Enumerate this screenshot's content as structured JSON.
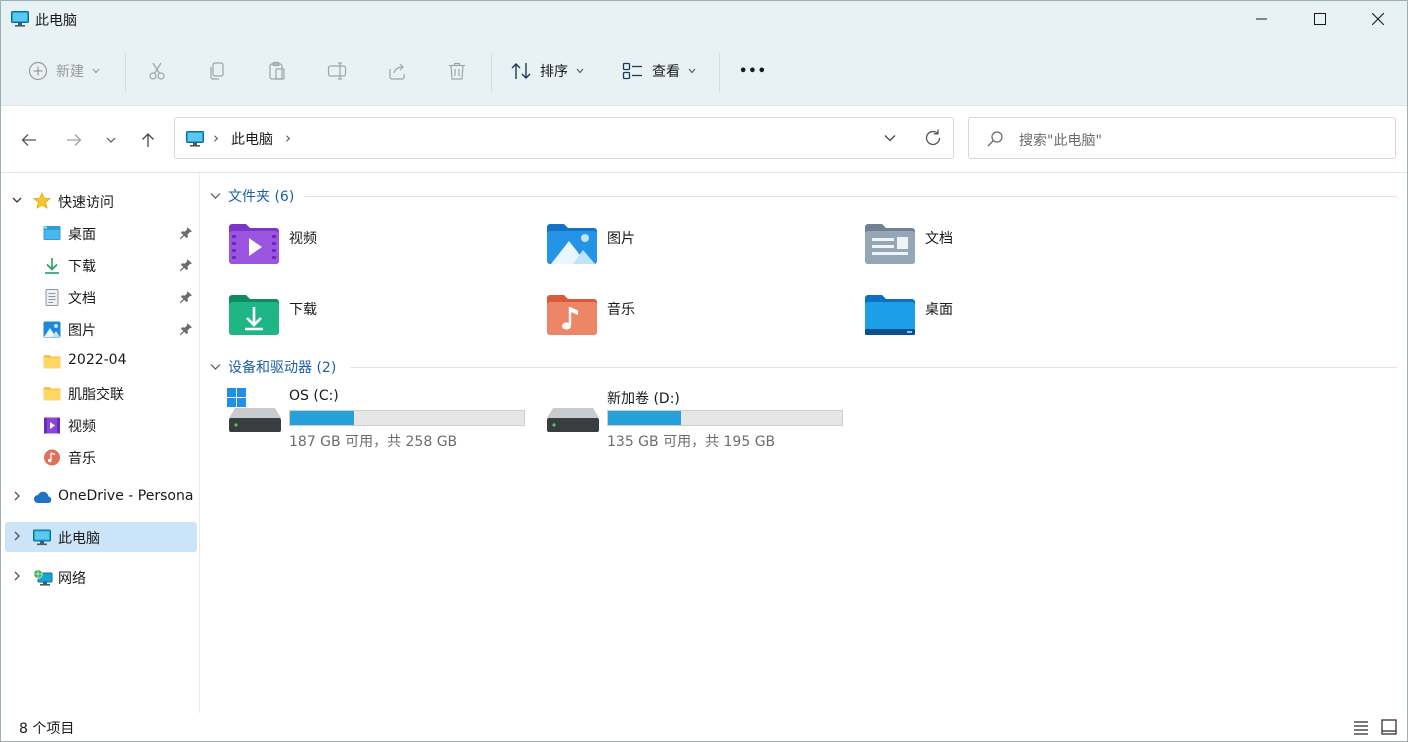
{
  "window": {
    "title": "此电脑",
    "controls": [
      "minimize-icon",
      "maximize-icon",
      "close-icon"
    ]
  },
  "toolbar": {
    "new_label": "新建",
    "sort_label": "排序",
    "view_label": "查看",
    "more_label": "•••"
  },
  "address": {
    "separator": "›",
    "location": "此电脑",
    "search_placeholder": "搜索\"此电脑\""
  },
  "sidebar": {
    "quick_access": "快速访问",
    "items": [
      {
        "label": "桌面",
        "icon": "desktop-folder-icon",
        "pinned": true
      },
      {
        "label": "下载",
        "icon": "download-icon",
        "pinned": true
      },
      {
        "label": "文档",
        "icon": "document-icon",
        "pinned": true
      },
      {
        "label": "图片",
        "icon": "pictures-icon",
        "pinned": true
      },
      {
        "label": "2022-04",
        "icon": "folder-icon",
        "pinned": false
      },
      {
        "label": "肌脂交联",
        "icon": "folder-icon",
        "pinned": false
      },
      {
        "label": "视频",
        "icon": "videos-icon",
        "pinned": false
      },
      {
        "label": "音乐",
        "icon": "music-icon",
        "pinned": false
      }
    ],
    "onedrive": "OneDrive - Persona",
    "this_pc": "此电脑",
    "network": "网络"
  },
  "main": {
    "folders_header": "文件夹 (6)",
    "folders": [
      {
        "name": "视频",
        "icon": "videos-folder-icon"
      },
      {
        "name": "图片",
        "icon": "pictures-folder-icon"
      },
      {
        "name": "文档",
        "icon": "documents-folder-icon"
      },
      {
        "name": "下载",
        "icon": "downloads-folder-icon"
      },
      {
        "name": "音乐",
        "icon": "music-folder-icon"
      },
      {
        "name": "桌面",
        "icon": "desktop-folder-icon"
      }
    ],
    "drives_header": "设备和驱动器 (2)",
    "drives": [
      {
        "name": "OS (C:)",
        "info": "187 GB 可用，共 258 GB",
        "used_fraction": 0.275,
        "os": true
      },
      {
        "name": "新加卷 (D:)",
        "info": "135 GB 可用，共 195 GB",
        "used_fraction": 0.31,
        "os": false
      }
    ]
  },
  "status": {
    "count": "8 个项目"
  },
  "colors": {
    "accent": "#26a0da",
    "group_header": "#1c5fa8",
    "selection": "#cce4f7",
    "chrome": "#e8f2f5"
  }
}
